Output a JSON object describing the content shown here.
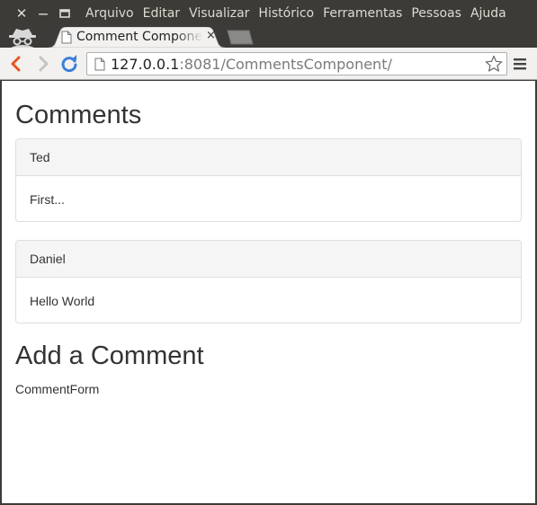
{
  "window": {
    "controls": {
      "close": "✕",
      "minimize": "—",
      "maximize": "▭"
    },
    "menu": [
      "Arquivo",
      "Editar",
      "Visualizar",
      "Histórico",
      "Ferramentas",
      "Pessoas",
      "Ajuda"
    ]
  },
  "tab": {
    "title": "Comment Component",
    "close": "×",
    "icon": "page-icon"
  },
  "toolbar": {
    "url_host": "127.0.0.1",
    "url_rest": ":8081/CommentsComponent/",
    "icons": [
      "back-icon",
      "forward-icon",
      "reload-icon",
      "page-icon",
      "star-icon",
      "menu-icon"
    ]
  },
  "page": {
    "heading": "Comments",
    "comments": [
      {
        "author": "Ted",
        "text": "First..."
      },
      {
        "author": "Daniel",
        "text": "Hello World"
      }
    ],
    "add_heading": "Add a Comment",
    "form_placeholder": "CommentForm"
  },
  "colors": {
    "titlebar": "#3c3b37",
    "toolbar": "#f2f1f0",
    "reload_blue": "#3b7fd9",
    "back_orange": "#e9541f",
    "panel_heading_bg": "#f5f5f5",
    "panel_border": "#dddddd",
    "text": "#333333"
  }
}
